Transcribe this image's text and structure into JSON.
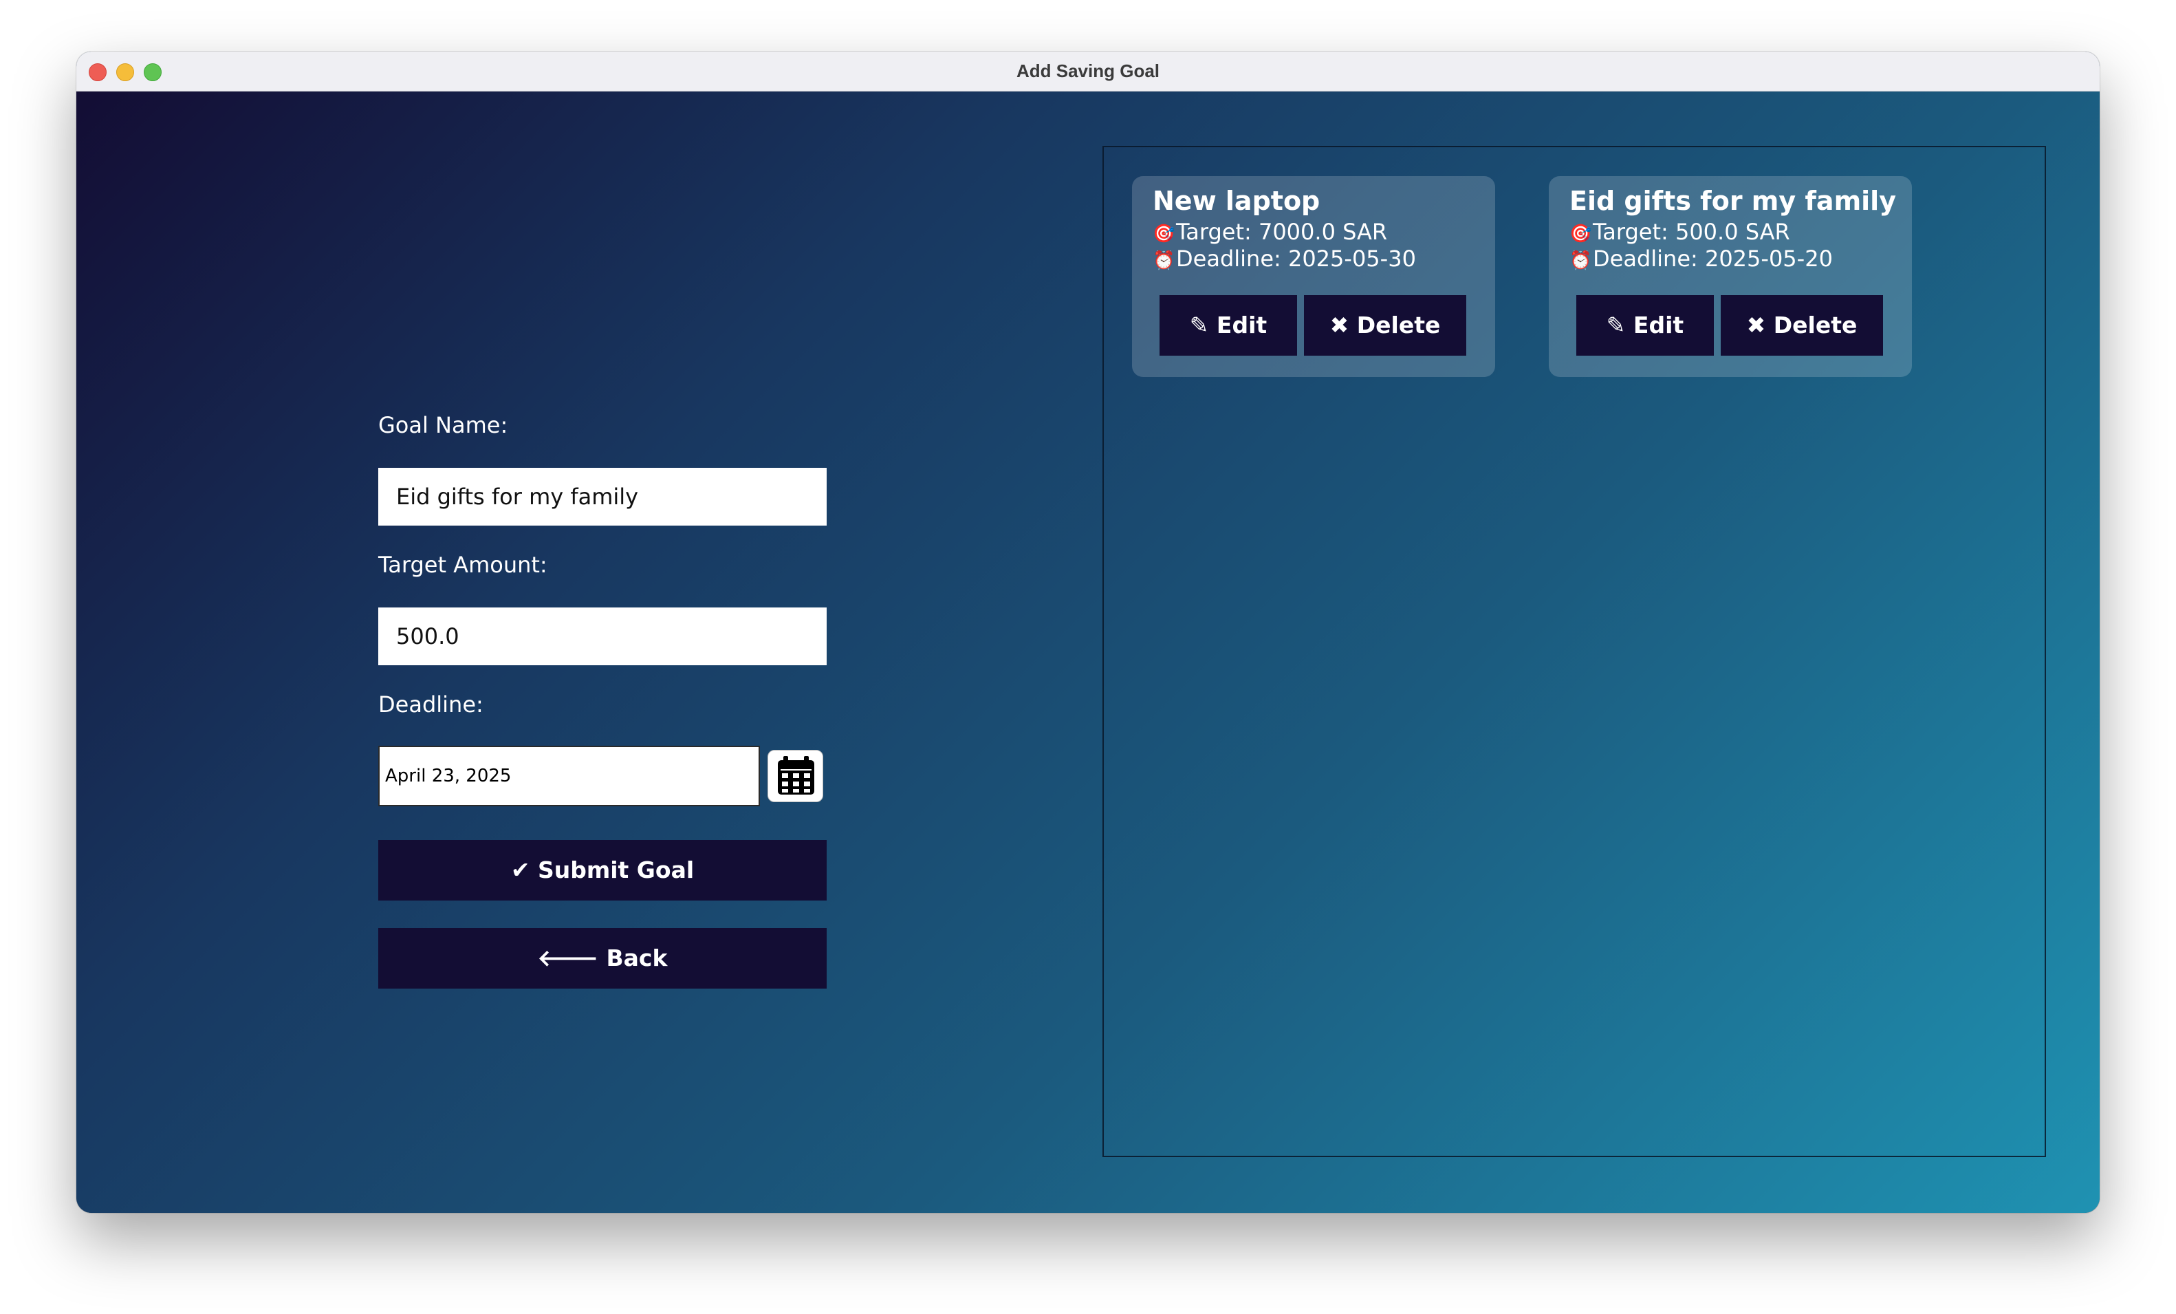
{
  "window": {
    "title": "Add Saving Goal"
  },
  "form": {
    "goal_name_label": "Goal Name:",
    "goal_name_value": "Eid gifts for my family",
    "target_amount_label": "Target Amount:",
    "target_amount_value": "500.0",
    "deadline_label": "Deadline:",
    "deadline_value": "April 23, 2025",
    "calendar_icon": "calendar-icon",
    "submit_label": "✔ Submit Goal",
    "back_label": "🡐 Back"
  },
  "goals": [
    {
      "name": "New laptop",
      "target_icon": "🎯",
      "target_text": "Target: 7000.0 SAR",
      "deadline_icon": "⏰",
      "deadline_text": "Deadline: 2025-05-30",
      "edit_label": "✎ Edit",
      "delete_label": "✖ Delete"
    },
    {
      "name": "Eid gifts for my family",
      "target_icon": "🎯",
      "target_text": "Target: 500.0 SAR",
      "deadline_icon": "⏰",
      "deadline_text": "Deadline: 2025-05-20",
      "edit_label": "✎ Edit",
      "delete_label": "✖ Delete"
    }
  ],
  "colors": {
    "button_bg": "#130d34",
    "gradient_start": "#130d34",
    "gradient_end": "#1f92b2"
  }
}
